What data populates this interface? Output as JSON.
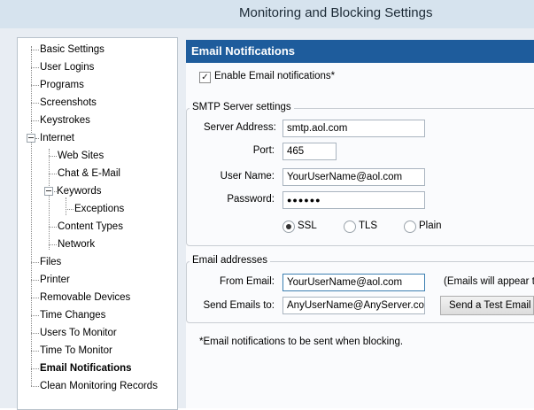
{
  "window": {
    "title": "Monitoring and Blocking Settings"
  },
  "tree": {
    "items": [
      {
        "label": "Basic Settings"
      },
      {
        "label": "User Logins"
      },
      {
        "label": "Programs"
      },
      {
        "label": "Screenshots"
      },
      {
        "label": "Keystrokes"
      },
      {
        "label": "Internet"
      },
      {
        "label": "Web Sites"
      },
      {
        "label": "Chat & E-Mail"
      },
      {
        "label": "Keywords"
      },
      {
        "label": "Exceptions"
      },
      {
        "label": "Content Types"
      },
      {
        "label": "Network"
      },
      {
        "label": "Files"
      },
      {
        "label": "Printer"
      },
      {
        "label": "Removable Devices"
      },
      {
        "label": "Time Changes"
      },
      {
        "label": "Users To Monitor"
      },
      {
        "label": "Time To Monitor"
      },
      {
        "label": "Email Notifications",
        "selected": true
      },
      {
        "label": "Clean Monitoring Records"
      }
    ]
  },
  "panel": {
    "header": "Email Notifications",
    "enable_label": "Enable Email notifications*",
    "enable_checked": true,
    "smtp": {
      "title": "SMTP Server settings",
      "server_label": "Server Address:",
      "server_value": "smtp.aol.com",
      "port_label": "Port:",
      "port_value": "465",
      "user_label": "User Name:",
      "user_value": "YourUserName@aol.com",
      "password_label": "Password:",
      "password_value": "●●●●●●",
      "security_options": [
        "SSL",
        "TLS",
        "Plain"
      ],
      "security_selected": "SSL"
    },
    "emails": {
      "title": "Email addresses",
      "from_label": "From Email:",
      "from_value": "YourUserName@aol.com",
      "from_note": "(Emails will appear to b",
      "to_label": "Send Emails to:",
      "to_value": "AnyUserName@AnyServer.com",
      "test_button": "Send a Test Email N"
    },
    "footnote": "*Email notifications to be sent when blocking."
  }
}
